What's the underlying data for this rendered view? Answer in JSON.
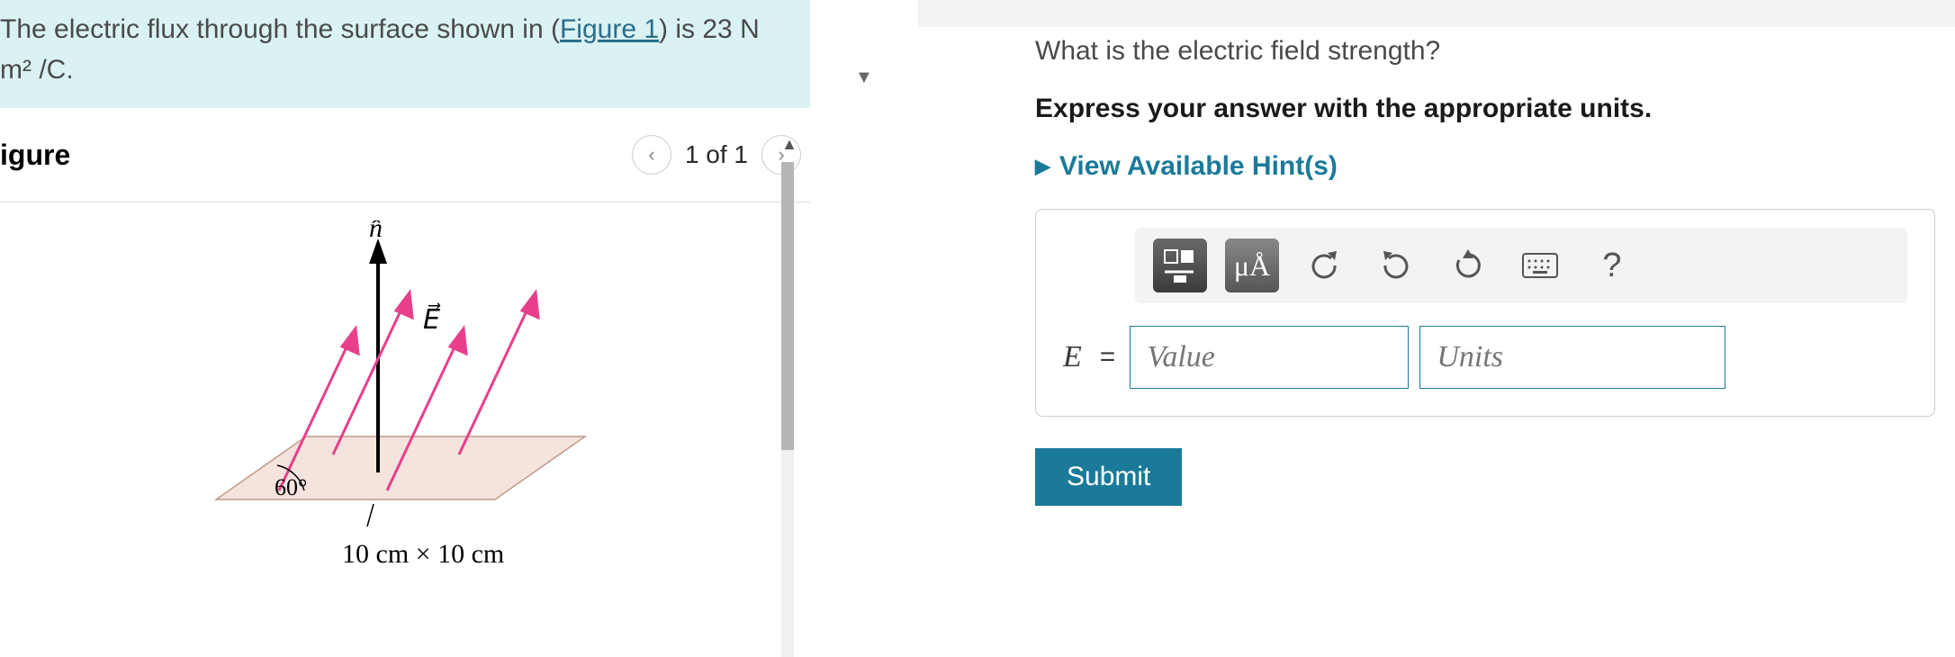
{
  "problem": {
    "prefix": "The electric flux through the surface shown in (",
    "link": "Figure 1",
    "suffix": ") is 23 N m² /C."
  },
  "figure": {
    "title": "igure",
    "nav_count": "1 of 1",
    "labels": {
      "n_hat": "n̂",
      "e_vec": "E⃗",
      "angle": "60°",
      "dims": "10 cm × 10 cm"
    }
  },
  "right": {
    "question": "What is the electric field strength?",
    "instruction": "Express your answer with the appropriate units.",
    "hints": "View Available Hint(s)",
    "toolbar": {
      "units_btn": "μÅ",
      "help": "?"
    },
    "answer": {
      "var": "E",
      "equals": "=",
      "value_ph": "Value",
      "units_ph": "Units"
    },
    "submit": "Submit"
  }
}
